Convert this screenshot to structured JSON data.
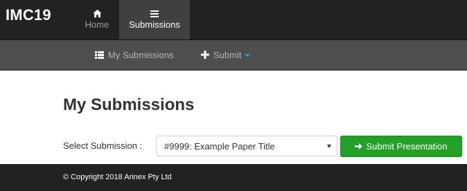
{
  "navbar": {
    "brand": "IMC19",
    "items": [
      {
        "label": "Home",
        "icon": "home-icon",
        "active": false
      },
      {
        "label": "Submissions",
        "icon": "list-icon",
        "active": true
      }
    ]
  },
  "subnav": {
    "my_submissions": {
      "label": "My Submissions",
      "icon": "list-icon"
    },
    "submit": {
      "label": "Submit",
      "icon": "plus-icon",
      "has_dropdown": true
    }
  },
  "main": {
    "title": "My Submissions",
    "select_label": "Select Submission :",
    "selected_submission": "#9999: Example Paper Title",
    "submit_button": {
      "label": "Submit Presentation",
      "icon": "arrow-right-icon"
    }
  },
  "footer": {
    "copyright": "© Copyright 2018 Arinex Pty Ltd"
  },
  "colors": {
    "navbar_bg": "#222222",
    "subnav_bg": "#4e4e4e",
    "active_tab_bg": "#404040",
    "accent_caret": "#2a9fd6",
    "button_green": "#23a127"
  }
}
